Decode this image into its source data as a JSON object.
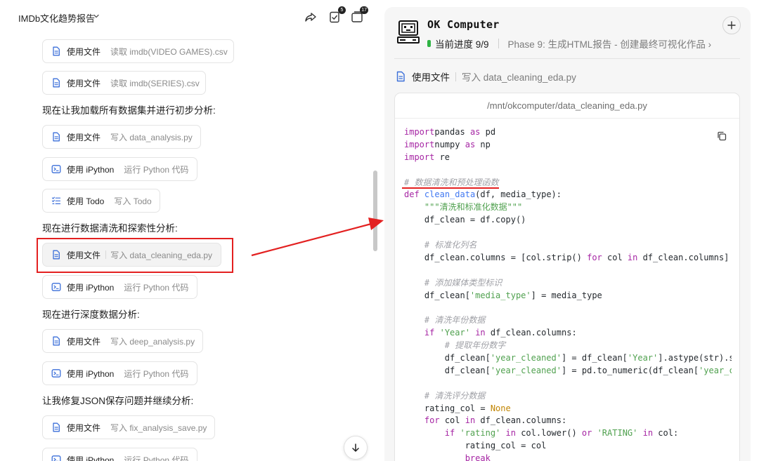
{
  "header": {
    "project_title": "IMDb文化趋势报告",
    "share_label": "share",
    "tasks_badge": "5",
    "windows_badge": "17"
  },
  "left_flow": [
    {
      "kind": "card",
      "icon": "file-icon",
      "action": "使用文件",
      "detail": "读取 imdb(VIDEO GAMES).csv"
    },
    {
      "kind": "card",
      "icon": "file-icon",
      "action": "使用文件",
      "detail": "读取 imdb(SERIES).csv"
    },
    {
      "kind": "msg",
      "text": "现在让我加载所有数据集并进行初步分析:"
    },
    {
      "kind": "card",
      "icon": "file-icon",
      "action": "使用文件",
      "detail": "写入 data_analysis.py"
    },
    {
      "kind": "card",
      "icon": "terminal-icon",
      "action": "使用 iPython",
      "detail": "运行 Python 代码"
    },
    {
      "kind": "card",
      "icon": "todo-icon",
      "action": "使用 Todo",
      "detail": "写入 Todo"
    },
    {
      "kind": "msg",
      "text": "现在进行数据清洗和探索性分析:"
    },
    {
      "kind": "card",
      "icon": "file-icon",
      "action": "使用文件",
      "detail": "写入 data_cleaning_eda.py",
      "selected": true
    },
    {
      "kind": "card",
      "icon": "terminal-icon",
      "action": "使用 iPython",
      "detail": "运行 Python 代码"
    },
    {
      "kind": "msg",
      "text": "现在进行深度数据分析:"
    },
    {
      "kind": "card",
      "icon": "file-icon",
      "action": "使用文件",
      "detail": "写入 deep_analysis.py"
    },
    {
      "kind": "card",
      "icon": "terminal-icon",
      "action": "使用 iPython",
      "detail": "运行 Python 代码"
    },
    {
      "kind": "msg",
      "text": "让我修复JSON保存问题并继续分析:"
    },
    {
      "kind": "card",
      "icon": "file-icon",
      "action": "使用文件",
      "detail": "写入 fix_analysis_save.py"
    },
    {
      "kind": "card",
      "icon": "terminal-icon",
      "action": "使用 iPython",
      "detail": "运行 Python 代码"
    }
  ],
  "computer": {
    "title": "OK Computer",
    "progress": "当前进度 9/9",
    "phase": "Phase 9: 生成HTML报告 - 创建最终可视化作品 ›",
    "file_action": "使用文件",
    "file_detail": "写入 data_cleaning_eda.py",
    "file_path": "/mnt/okcomputer/data_cleaning_eda.py"
  },
  "code_lines": [
    [
      [
        "k",
        "import"
      ],
      [
        "",
        "pandas "
      ],
      [
        "k",
        "as"
      ],
      [
        "",
        " pd"
      ]
    ],
    [
      [
        "k",
        "import"
      ],
      [
        "",
        "numpy "
      ],
      [
        "k",
        "as"
      ],
      [
        "",
        " np"
      ]
    ],
    [
      [
        "k",
        "import"
      ],
      [
        "",
        " re"
      ]
    ],
    [
      [
        "",
        ""
      ]
    ],
    [
      [
        "c",
        "# 数据清洗和预处理函数"
      ]
    ],
    [
      [
        "k",
        "def"
      ],
      [
        "",
        " "
      ],
      [
        "f",
        "clean_data"
      ],
      [
        "",
        "(df, media_type):"
      ]
    ],
    [
      [
        "",
        "    "
      ],
      [
        "s",
        "\"\"\"清洗和标准化数据\"\"\""
      ]
    ],
    [
      [
        "",
        "    df_clean = df.copy()"
      ]
    ],
    [
      [
        "",
        ""
      ]
    ],
    [
      [
        "",
        "    "
      ],
      [
        "c",
        "# 标准化列名"
      ]
    ],
    [
      [
        "",
        "    df_clean.columns = [col.strip() "
      ],
      [
        "k",
        "for"
      ],
      [
        "",
        " col "
      ],
      [
        "k",
        "in"
      ],
      [
        "",
        " df_clean.columns]"
      ]
    ],
    [
      [
        "",
        ""
      ]
    ],
    [
      [
        "",
        "    "
      ],
      [
        "c",
        "# 添加媒体类型标识"
      ]
    ],
    [
      [
        "",
        "    df_clean["
      ],
      [
        "s",
        "'media_type'"
      ],
      [
        "",
        "] = media_type"
      ]
    ],
    [
      [
        "",
        ""
      ]
    ],
    [
      [
        "",
        "    "
      ],
      [
        "c",
        "# 清洗年份数据"
      ]
    ],
    [
      [
        "",
        "    "
      ],
      [
        "k",
        "if"
      ],
      [
        "",
        " "
      ],
      [
        "s",
        "'Year'"
      ],
      [
        "",
        " "
      ],
      [
        "k",
        "in"
      ],
      [
        "",
        " df_clean.columns:"
      ]
    ],
    [
      [
        "",
        "        "
      ],
      [
        "c",
        "# 提取年份数字"
      ]
    ],
    [
      [
        "",
        "        df_clean["
      ],
      [
        "s",
        "'year_cleaned'"
      ],
      [
        "",
        "] = df_clean["
      ],
      [
        "s",
        "'Year'"
      ],
      [
        "",
        "].astype(str).s"
      ]
    ],
    [
      [
        "",
        "        df_clean["
      ],
      [
        "s",
        "'year_cleaned'"
      ],
      [
        "",
        "] = pd.to_numeric(df_clean["
      ],
      [
        "s",
        "'year_c"
      ]
    ],
    [
      [
        "",
        ""
      ]
    ],
    [
      [
        "",
        "    "
      ],
      [
        "c",
        "# 清洗评分数据"
      ]
    ],
    [
      [
        "",
        "    rating_col = "
      ],
      [
        "n",
        "None"
      ]
    ],
    [
      [
        "",
        "    "
      ],
      [
        "k",
        "for"
      ],
      [
        "",
        " col "
      ],
      [
        "k",
        "in"
      ],
      [
        "",
        " df_clean.columns:"
      ]
    ],
    [
      [
        "",
        "        "
      ],
      [
        "k",
        "if"
      ],
      [
        "",
        " "
      ],
      [
        "s",
        "'rating'"
      ],
      [
        "",
        " "
      ],
      [
        "k",
        "in"
      ],
      [
        "",
        " col.lower() "
      ],
      [
        "k",
        "or"
      ],
      [
        "",
        " "
      ],
      [
        "s",
        "'RATING'"
      ],
      [
        "",
        " "
      ],
      [
        "k",
        "in"
      ],
      [
        "",
        " col:"
      ]
    ],
    [
      [
        "",
        "            rating_col = col"
      ]
    ],
    [
      [
        "",
        "            "
      ],
      [
        "k",
        "break"
      ]
    ]
  ]
}
